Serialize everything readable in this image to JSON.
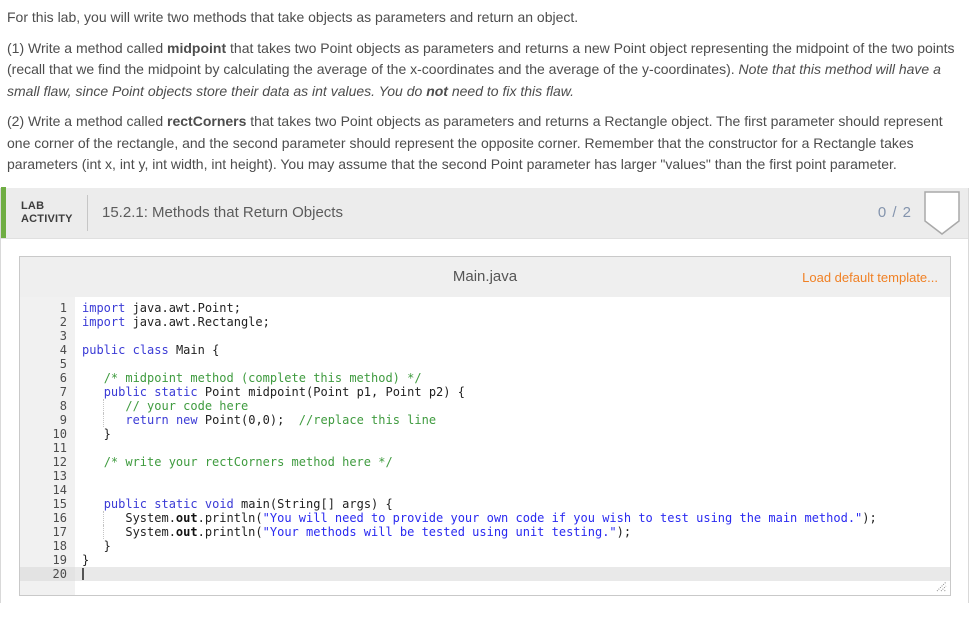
{
  "instructions": {
    "paragraphs": [
      {
        "runs": [
          {
            "t": "For this lab, you will write two methods that take objects as parameters and return an object."
          }
        ]
      },
      {
        "runs": [
          {
            "t": "(1) Write a method called "
          },
          {
            "t": "midpoint",
            "b": true
          },
          {
            "t": " that takes two Point objects as parameters and returns a new Point object representing the midpoint of the two points (recall that we find the midpoint by calculating the average of the x-coordinates and the average of the y-coordinates). "
          },
          {
            "t": "Note that this method will have a small flaw, since Point objects store their data as int values. You do ",
            "i": true
          },
          {
            "t": "not",
            "b": true,
            "i": true
          },
          {
            "t": " need to fix this flaw.",
            "i": true
          }
        ]
      },
      {
        "runs": [
          {
            "t": "(2) Write a method called "
          },
          {
            "t": "rectCorners",
            "b": true
          },
          {
            "t": " that takes two Point objects as parameters and returns a Rectangle object. The first parameter should represent one corner of the rectangle, and the second parameter should represent the opposite corner. Remember that the constructor for a Rectangle takes parameters (int x, int y, int width, int height). You may assume that the second Point parameter has larger \"values\" than the first point parameter."
          }
        ]
      }
    ]
  },
  "lab_header": {
    "badge_line1": "LAB",
    "badge_line2": "ACTIVITY",
    "title": "15.2.1: Methods that Return Objects",
    "score": "0 / 2"
  },
  "editor": {
    "filename": "Main.java",
    "load_template_label": "Load default template...",
    "code_lines": [
      {
        "num": 1,
        "seg": [
          {
            "t": "import",
            "c": "k"
          },
          {
            "t": " java.awt.Point;"
          }
        ]
      },
      {
        "num": 2,
        "seg": [
          {
            "t": "import",
            "c": "k"
          },
          {
            "t": " java.awt.Rectangle;"
          }
        ]
      },
      {
        "num": 3,
        "seg": []
      },
      {
        "num": 4,
        "seg": [
          {
            "t": "public",
            "c": "k"
          },
          {
            "t": " "
          },
          {
            "t": "class",
            "c": "k"
          },
          {
            "t": " Main {"
          }
        ]
      },
      {
        "num": 5,
        "seg": []
      },
      {
        "num": 6,
        "seg": [
          {
            "t": "   "
          },
          {
            "t": "/* midpoint method (complete this method) */",
            "c": "c"
          }
        ]
      },
      {
        "num": 7,
        "seg": [
          {
            "t": "   "
          },
          {
            "t": "public",
            "c": "k"
          },
          {
            "t": " "
          },
          {
            "t": "static",
            "c": "k"
          },
          {
            "t": " Point midpoint(Point p1, Point p2) {"
          }
        ]
      },
      {
        "num": 8,
        "g": true,
        "seg": [
          {
            "t": "      "
          },
          {
            "t": "// your code here",
            "c": "c"
          }
        ]
      },
      {
        "num": 9,
        "g": true,
        "seg": [
          {
            "t": "      "
          },
          {
            "t": "return",
            "c": "k"
          },
          {
            "t": " "
          },
          {
            "t": "new",
            "c": "k"
          },
          {
            "t": " Point(0,0);  "
          },
          {
            "t": "//replace this line",
            "c": "c"
          }
        ]
      },
      {
        "num": 10,
        "seg": [
          {
            "t": "   }"
          }
        ]
      },
      {
        "num": 11,
        "seg": []
      },
      {
        "num": 12,
        "seg": [
          {
            "t": "   "
          },
          {
            "t": "/* write your rectCorners method here */",
            "c": "c"
          }
        ]
      },
      {
        "num": 13,
        "seg": []
      },
      {
        "num": 14,
        "seg": []
      },
      {
        "num": 15,
        "seg": [
          {
            "t": "   "
          },
          {
            "t": "public",
            "c": "k"
          },
          {
            "t": " "
          },
          {
            "t": "static",
            "c": "k"
          },
          {
            "t": " "
          },
          {
            "t": "void",
            "c": "k"
          },
          {
            "t": " main(String[] args) {"
          }
        ]
      },
      {
        "num": 16,
        "g": true,
        "seg": [
          {
            "t": "      System."
          },
          {
            "t": "out",
            "c": "b"
          },
          {
            "t": ".println("
          },
          {
            "t": "\"You will need to provide your own code if you wish to test using the main method.\"",
            "c": "s"
          },
          {
            "t": ");"
          }
        ]
      },
      {
        "num": 17,
        "g": true,
        "seg": [
          {
            "t": "      System."
          },
          {
            "t": "out",
            "c": "b"
          },
          {
            "t": ".println("
          },
          {
            "t": "\"Your methods will be tested using unit testing.\"",
            "c": "s"
          },
          {
            "t": ");"
          }
        ]
      },
      {
        "num": 18,
        "seg": [
          {
            "t": "   }"
          }
        ]
      },
      {
        "num": 19,
        "seg": [
          {
            "t": "}"
          }
        ]
      },
      {
        "num": 20,
        "active": true,
        "seg": []
      }
    ]
  },
  "colors": {
    "accent_green": "#6fad43",
    "score_text": "#8494ad",
    "link_orange": "#f08125",
    "code_keyword": "#3b3bd6",
    "code_string": "#2a2af0",
    "code_comment": "#3f9b3f"
  }
}
